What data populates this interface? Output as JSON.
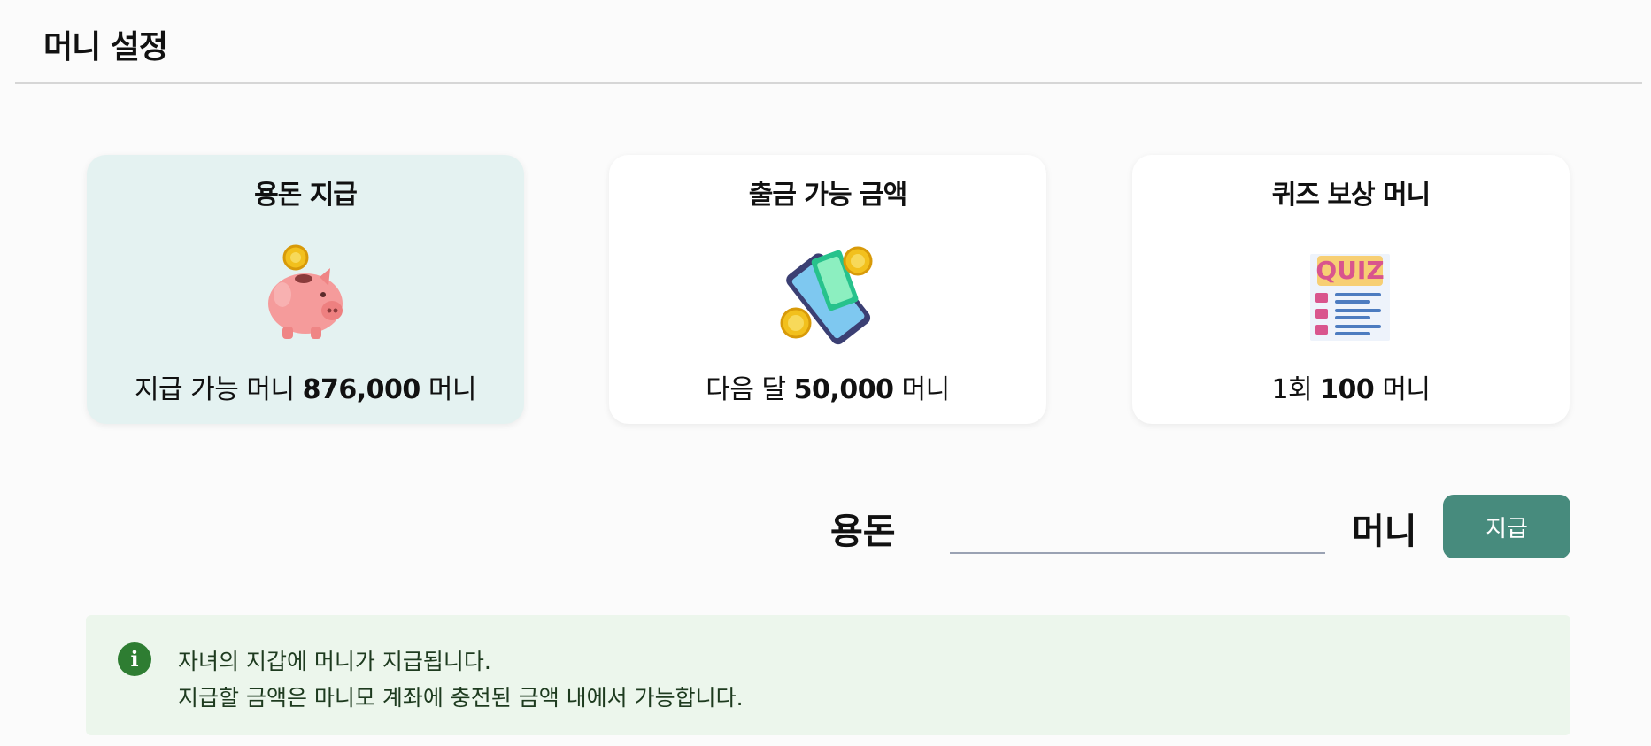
{
  "page": {
    "title": "머니 설정"
  },
  "cards": [
    {
      "title": "용돈 지급",
      "icon": "piggy-bank-icon",
      "desc_prefix": "지급 가능 머니 ",
      "desc_value": "876,000",
      "desc_suffix": " 머니"
    },
    {
      "title": "출금 가능 금액",
      "icon": "phone-money-icon",
      "desc_prefix": "다음 달 ",
      "desc_value": "50,000",
      "desc_suffix": " 머니"
    },
    {
      "title": "퀴즈 보상 머니",
      "icon": "quiz-document-icon",
      "desc_prefix": "1회 ",
      "desc_value": "100",
      "desc_suffix": " 머니"
    }
  ],
  "allowance": {
    "label": "용돈",
    "value": "",
    "placeholder": "",
    "unit": "머니",
    "button_label": "지급"
  },
  "info": {
    "icon": "info-icon",
    "lines": [
      "자녀의 지갑에 머니가 지급됩니다.",
      "지급할 금액은 마니모 계좌에 충전된 금액 내에서 가능합니다."
    ]
  },
  "colors": {
    "accent": "#478b7d",
    "active_card_bg": "#e4f2f1",
    "info_bg": "#ecf6ec",
    "info_icon": "#2e7d32"
  }
}
